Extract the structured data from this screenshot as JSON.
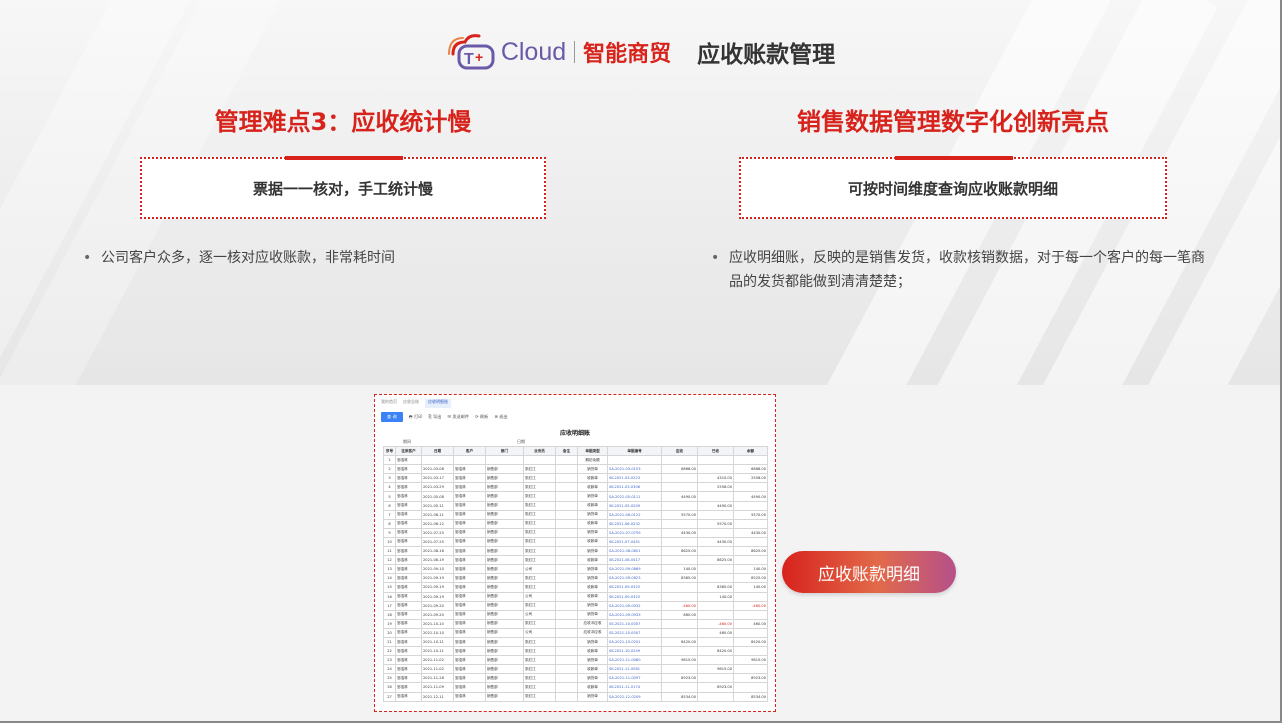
{
  "header": {
    "logo_cloud": "Cloud",
    "logo_cn": "智能商贸",
    "title": "应收账款管理"
  },
  "left": {
    "title": "管理难点3：应收统计慢",
    "box_text": "票据一一核对，手工统计慢",
    "bullet": "公司客户众多，逐一核对应收账款，非常耗时间"
  },
  "right": {
    "title": "销售数据管理数字化创新亮点",
    "box_text": "可按时间维度查询应收账款明细",
    "bullet_line1": "应收明细账，反映的是销售发货，收款核销数据，对于每一个客户的每一笔商",
    "bullet_line2": "品的发货都能做到清清楚楚；"
  },
  "screenshot": {
    "tabs": [
      "我的首页",
      "应收总账",
      "应收明细账"
    ],
    "toolbar": {
      "query": "查 询",
      "print": "打印",
      "export": "导出",
      "mail": "发送邮件",
      "refresh": "刷新",
      "exit": "退出"
    },
    "report_title": "应收明细账",
    "meta_period_label": "期间",
    "meta_date_label": "日期",
    "columns": [
      "序号",
      "往来客户",
      "日期",
      "客户",
      "部门",
      "业务员",
      "备注",
      "单据类型",
      "单据编号",
      "应收",
      "已收",
      "余额"
    ],
    "rows": [
      [
        "1",
        "邹浩林",
        "",
        "",
        "",
        "",
        "",
        "期初余额",
        "",
        "",
        "",
        ""
      ],
      [
        "2",
        "邹浩林",
        "2021-03-08",
        "邹浩林",
        "销售部",
        "张红江",
        "",
        "销货单",
        "SA-2021-03-0153",
        "6868.00",
        "",
        "6868.00"
      ],
      [
        "3",
        "邹浩林",
        "2021-03-17",
        "邹浩林",
        "销售部",
        "张红江",
        "",
        "收款单",
        "SK-2021-03-0223",
        "",
        "4310.00",
        "2558.00"
      ],
      [
        "4",
        "邹浩林",
        "2021-03-29",
        "邹浩林",
        "销售部",
        "张红江",
        "",
        "收款单",
        "SK-2021-03-0306",
        "",
        "2558.00",
        ""
      ],
      [
        "5",
        "邹浩林",
        "2021-05-08",
        "邹浩林",
        "销售部",
        "张红江",
        "",
        "销货单",
        "SA-2021-05-0111",
        "4490.00",
        "",
        "4490.00"
      ],
      [
        "6",
        "邹浩林",
        "2021-05-11",
        "邹浩林",
        "销售部",
        "张红江",
        "",
        "收款单",
        "SK-2021-05-0209",
        "",
        "4490.00",
        ""
      ],
      [
        "7",
        "邹浩林",
        "2021-06-11",
        "邹浩林",
        "销售部",
        "张红江",
        "",
        "销货单",
        "SA-2021-06-0122",
        "5570.00",
        "",
        "5570.00"
      ],
      [
        "8",
        "邹浩林",
        "2021-06-12",
        "邹浩林",
        "销售部",
        "张红江",
        "",
        "收款单",
        "SK-2021-06-0232",
        "",
        "5570.00",
        ""
      ],
      [
        "9",
        "邹浩林",
        "2021-07-25",
        "邹浩林",
        "销售部",
        "张红江",
        "",
        "销货单",
        "SA-2021-07-0759",
        "4430.00",
        "",
        "4430.00"
      ],
      [
        "10",
        "邹浩林",
        "2021-07-25",
        "邹浩林",
        "销售部",
        "张红江",
        "",
        "收款单",
        "SK-2021-07-0451",
        "",
        "4430.00",
        ""
      ],
      [
        "11",
        "邹浩林",
        "2021-08-16",
        "邹浩林",
        "销售部",
        "张红江",
        "",
        "销货单",
        "SA-2021-08-0601",
        "8625.00",
        "",
        "8625.00"
      ],
      [
        "12",
        "邹浩林",
        "2021-08-19",
        "邹浩林",
        "销售部",
        "张红江",
        "",
        "收款单",
        "SK-2021-08-0417",
        "",
        "8625.00",
        ""
      ],
      [
        "13",
        "邹浩林",
        "2021-09-10",
        "邹浩林",
        "销售部",
        "公司",
        "",
        "销货单",
        "SA-2021-09-0869",
        "140.00",
        "",
        "140.00"
      ],
      [
        "14",
        "邹浩林",
        "2021-09-19",
        "邹浩林",
        "销售部",
        "张红江",
        "",
        "销货单",
        "SA-2021-09-0823",
        "8385.00",
        "",
        "8525.00"
      ],
      [
        "15",
        "邹浩林",
        "2021-09-19",
        "邹浩林",
        "销售部",
        "张红江",
        "",
        "收款单",
        "SK-2021-09-0325",
        "",
        "8385.00",
        "140.00"
      ],
      [
        "16",
        "邹浩林",
        "2021-09-19",
        "邹浩林",
        "销售部",
        "公司",
        "",
        "收款单",
        "SK-2021-09-0325",
        "",
        "140.00",
        ""
      ],
      [
        "17",
        "邹浩林",
        "2021-09-20",
        "邹浩林",
        "销售部",
        "张红江",
        "",
        "销货单",
        "SA-2021-09-0032",
        "-460.00",
        "",
        "-460.00"
      ],
      [
        "18",
        "邹浩林",
        "2021-09-20",
        "邹浩林",
        "销售部",
        "公司",
        "",
        "销货单",
        "SA-2021-09-0933",
        "860.00",
        "",
        ""
      ],
      [
        "19",
        "邹浩林",
        "2021-10-10",
        "邹浩林",
        "销售部",
        "张红江",
        "",
        "应收冲应收",
        "SS-2021-10-0007",
        "",
        "-460.00",
        "460.00"
      ],
      [
        "20",
        "邹浩林",
        "2021-10-10",
        "邹浩林",
        "销售部",
        "公司",
        "",
        "应收冲应收",
        "SS-2021-10-0007",
        "",
        "460.00",
        ""
      ],
      [
        "21",
        "邹浩林",
        "2021-10-11",
        "邹浩林",
        "销售部",
        "张红江",
        "",
        "销货单",
        "SA-2021-10-0201",
        "8420.00",
        "",
        "8420.00"
      ],
      [
        "22",
        "邹浩林",
        "2021-10-11",
        "邹浩林",
        "销售部",
        "张红江",
        "",
        "收款单",
        "SK-2021-10-0249",
        "",
        "8420.00",
        ""
      ],
      [
        "23",
        "邹浩林",
        "2021-11-02",
        "邹浩林",
        "销售部",
        "张红江",
        "",
        "销货单",
        "SA-2021-11-0080",
        "9815.00",
        "",
        "9815.00"
      ],
      [
        "24",
        "邹浩林",
        "2021-11-02",
        "邹浩林",
        "销售部",
        "张红江",
        "",
        "收款单",
        "SK-2021-11-0081",
        "",
        "9815.00",
        ""
      ],
      [
        "25",
        "邹浩林",
        "2021-11-28",
        "邹浩林",
        "销售部",
        "张红江",
        "",
        "销货单",
        "SA-2021-11-0097",
        "8923.00",
        "",
        "8923.00"
      ],
      [
        "26",
        "邹浩林",
        "2021-11-09",
        "邹浩林",
        "销售部",
        "张红江",
        "",
        "收款单",
        "SK-2021-11-0174",
        "",
        "8923.00",
        ""
      ],
      [
        "27",
        "邹浩林",
        "2021-12-11",
        "邹浩林",
        "销售部",
        "张红江",
        "",
        "销货单",
        "SA-2021-12-0209",
        "8534.00",
        "",
        "8534.00"
      ]
    ]
  },
  "pill_button": "应收账款明细",
  "colors": {
    "accent": "#d7231c",
    "link_blue": "#3b63c8",
    "logo_purple": "#6a5aa8"
  }
}
